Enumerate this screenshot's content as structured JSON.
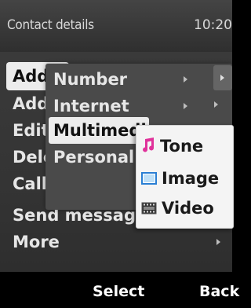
{
  "status": {
    "title": "Contact details",
    "time": "10:20"
  },
  "main_menu": {
    "items": [
      {
        "label": "Add",
        "selected": true
      },
      {
        "label": "Add"
      },
      {
        "label": "Edit"
      },
      {
        "label": "Delete"
      },
      {
        "label": "Call"
      },
      {
        "label": "Send message"
      },
      {
        "label": "More"
      }
    ]
  },
  "submenu1": {
    "items": [
      {
        "label": "Number"
      },
      {
        "label": "Internet"
      },
      {
        "label": "Multimedia",
        "selected": true
      },
      {
        "label": "Personal"
      }
    ]
  },
  "submenu2": {
    "items": [
      {
        "label": "Tone",
        "icon": "music-note-icon"
      },
      {
        "label": "Image",
        "icon": "image-icon"
      },
      {
        "label": "Video",
        "icon": "video-icon"
      }
    ]
  },
  "softkeys": {
    "left": "",
    "center": "Select",
    "right": "Back"
  },
  "colors": {
    "highlight": "#ececec",
    "tone_icon": "#e0319a",
    "image_icon": "#2a7fd4"
  }
}
